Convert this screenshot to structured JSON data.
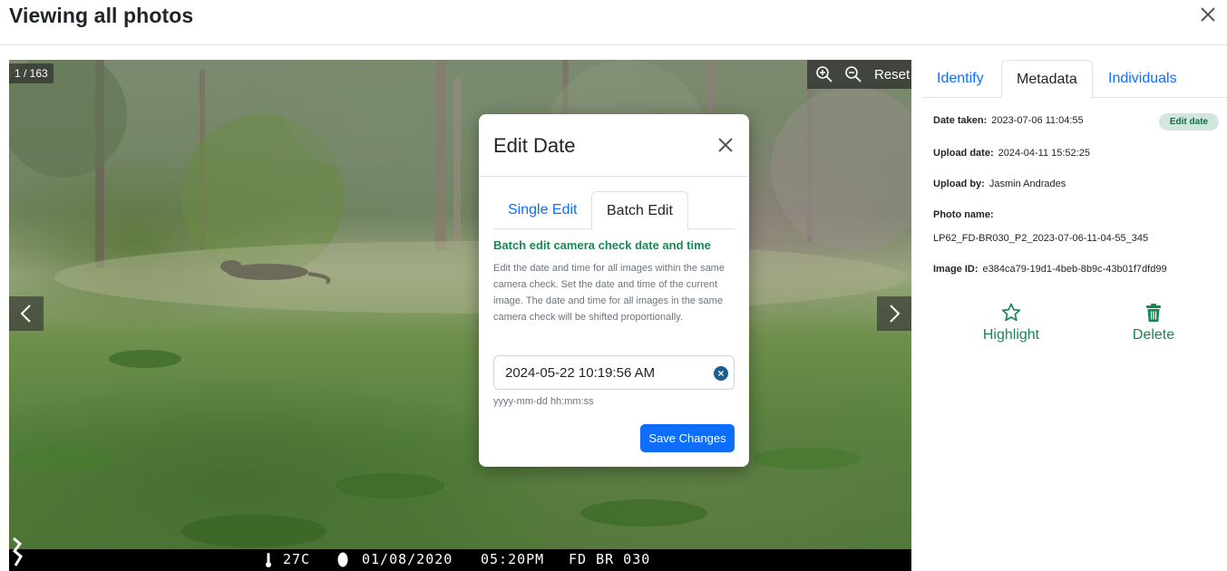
{
  "header": {
    "title": "Viewing all photos"
  },
  "viewer": {
    "counter": "1 / 163",
    "reset_label": "Reset",
    "camera_strip": {
      "temperature": "27C",
      "date": "01/08/2020",
      "time": "05:20PM",
      "camera": "FD BR 030"
    }
  },
  "modal": {
    "title": "Edit Date",
    "tabs": [
      {
        "label": "Single Edit",
        "active": false
      },
      {
        "label": "Batch Edit",
        "active": true
      }
    ],
    "heading": "Batch edit camera check date and time",
    "description": "Edit the date and time for all images within the same camera check. Set the date and time of the current image. The date and time for all images in the same camera check will be shifted proportionally.",
    "date_value": "2024-05-22 10:19:56 AM",
    "date_hint": "yyyy-mm-dd hh:mm:ss",
    "save_label": "Save Changes"
  },
  "panel": {
    "tabs": [
      {
        "label": "Identify",
        "active": false
      },
      {
        "label": "Metadata",
        "active": true
      },
      {
        "label": "Individuals",
        "active": false
      }
    ],
    "metadata": {
      "date_taken_label": "Date taken:",
      "date_taken": "2023-07-06 11:04:55",
      "edit_date_label": "Edit date",
      "upload_date_label": "Upload date:",
      "upload_date": "2024-04-11 15:52:25",
      "upload_by_label": "Upload by:",
      "upload_by": "Jasmin Andrades",
      "photo_name_label": "Photo name:",
      "photo_name": "LP62_FD-BR030_P2_2023-07-06-11-04-55_345",
      "image_id_label": "Image ID:",
      "image_id": "e384ca79-19d1-4beb-8b9c-43b01f7dfd99"
    },
    "actions": {
      "highlight_label": "Highlight",
      "delete_label": "Delete"
    }
  },
  "colors": {
    "primary": "#0d6efd",
    "success": "#198754",
    "badge_bg": "#d1e7dd"
  }
}
